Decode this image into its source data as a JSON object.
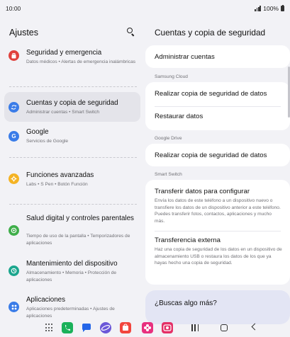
{
  "status": {
    "time": "10:00",
    "battery": "100%",
    "signal_icon": "signal-icon",
    "battery_icon": "battery-icon"
  },
  "left": {
    "title": "Ajustes",
    "search_icon": "search-icon",
    "items": [
      {
        "title": "Seguridad y emergencia",
        "subtitle": "Datos médicos • Alertas de emergencia inalámbricas",
        "icon": "emergency-icon",
        "color": "#e0413d",
        "selected": false
      },
      {
        "title": "Cuentas y copia de seguridad",
        "subtitle": "Administrar cuentas • Smart Switch",
        "icon": "sync-icon",
        "color": "#3a7ce8",
        "selected": true
      },
      {
        "title": "Google",
        "subtitle": "Servicios de Google",
        "icon": "google-icon",
        "color": "#3a7ce8",
        "selected": false
      },
      {
        "title": "Funciones avanzadas",
        "subtitle": "Labs • S Pen • Botón Función",
        "icon": "advanced-features-icon",
        "color": "#f4b324",
        "selected": false
      },
      {
        "title": "Salud digital y controles parentales",
        "subtitle": "Tiempo de uso de la pantalla • Temporizadores de aplicaciones",
        "icon": "digital-wellbeing-icon",
        "color": "#3fae4a",
        "selected": false
      },
      {
        "title": "Mantenimiento del dispositivo",
        "subtitle": "Almacenamiento • Memoria • Protección de aplicaciones",
        "icon": "device-care-icon",
        "color": "#1ca68e",
        "selected": false
      },
      {
        "title": "Aplicaciones",
        "subtitle": "Aplicaciones predeterminadas • Ajustes de aplicaciones",
        "icon": "apps-icon",
        "color": "#3a7ce8",
        "selected": false
      }
    ]
  },
  "right": {
    "title": "Cuentas y copia de seguridad",
    "manage_accounts": "Administrar cuentas",
    "samsung_cloud": {
      "label": "Samsung Cloud",
      "backup": "Realizar copia de seguridad de datos",
      "restore": "Restaurar datos"
    },
    "google_drive": {
      "label": "Google Drive",
      "backup": "Realizar copia de seguridad de datos"
    },
    "smart_switch": {
      "label": "Smart Switch",
      "transfer_title": "Transferir datos para configurar",
      "transfer_desc": "Envía los datos de este teléfono a un dispositivo nuevo o transfiere los datos de un dispositivo anterior a este teléfono. Puedes transferir fotos, contactos, aplicaciones y mucho más.",
      "external_title": "Transferencia externa",
      "external_desc": "Haz una copia de seguridad de los datos en un dispositivo de almacenamiento USB o restaura los datos de los que ya hayas hecho una copia de seguridad."
    },
    "suggest": "¿Buscas algo más?"
  },
  "dock": {
    "apps": [
      {
        "icon": "phone-app-icon",
        "color": "#1bb15a"
      },
      {
        "icon": "messages-app-icon",
        "color": "#2466e8"
      },
      {
        "icon": "internet-app-icon",
        "color": "#6b57d8"
      },
      {
        "icon": "galaxy-store-icon",
        "color": "#f2453d"
      },
      {
        "icon": "blossom-app-icon",
        "color": "#e8307e"
      },
      {
        "icon": "camera-app-icon",
        "color": "#e43067"
      }
    ],
    "apps_grid_icon": "apps-grid-icon",
    "recents_icon": "recents-icon",
    "home_icon": "home-icon",
    "back_icon": "back-icon"
  }
}
